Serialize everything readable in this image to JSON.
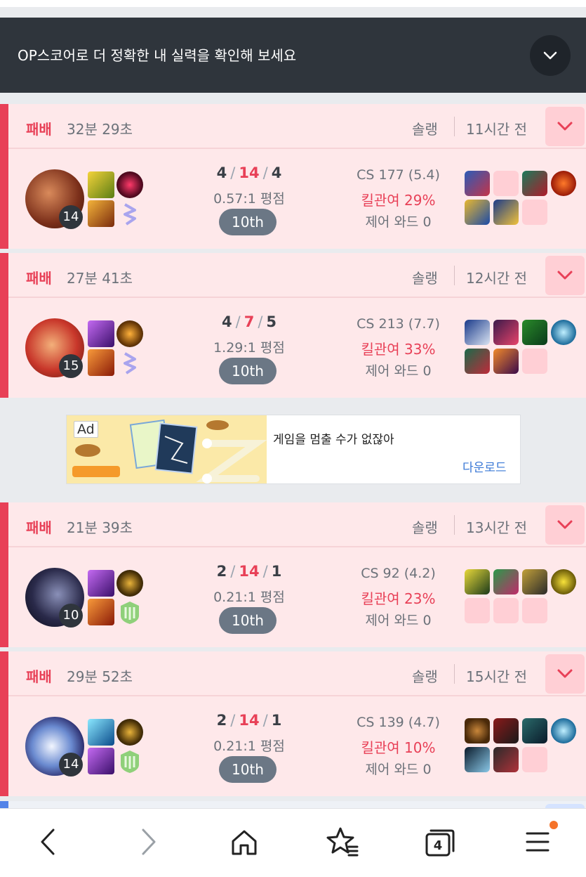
{
  "banner": {
    "text": "OP스코어로 더 정확한 내 실력을 확인해 보세요"
  },
  "matches": [
    {
      "result": "패배",
      "duration": "32분 29초",
      "queue": "솔랭",
      "ago": "11시간 전",
      "level": "14",
      "kills": "4",
      "deaths": "14",
      "assists": "4",
      "ratio": "0.57:1 평점",
      "placement": "10th",
      "cs": "CS 177 (5.4)",
      "kp": "킬관여 29%",
      "ward": "제어 와드 0"
    },
    {
      "result": "패배",
      "duration": "27분 41초",
      "queue": "솔랭",
      "ago": "12시간 전",
      "level": "15",
      "kills": "4",
      "deaths": "7",
      "assists": "5",
      "ratio": "1.29:1 평점",
      "placement": "10th",
      "cs": "CS 213 (7.7)",
      "kp": "킬관여 33%",
      "ward": "제어 와드 0"
    },
    {
      "result": "패배",
      "duration": "21분 39초",
      "queue": "솔랭",
      "ago": "13시간 전",
      "level": "10",
      "kills": "2",
      "deaths": "14",
      "assists": "1",
      "ratio": "0.21:1 평점",
      "placement": "10th",
      "cs": "CS 92 (4.2)",
      "kp": "킬관여 23%",
      "ward": "제어 와드 0"
    },
    {
      "result": "패배",
      "duration": "29분 52초",
      "queue": "솔랭",
      "ago": "15시간 전",
      "level": "14",
      "kills": "2",
      "deaths": "14",
      "assists": "1",
      "ratio": "0.21:1 평점",
      "placement": "10th",
      "cs": "CS 139 (4.7)",
      "kp": "킬관여 10%",
      "ward": "제어 와드 0"
    }
  ],
  "ad": {
    "badge": "Ad",
    "title": "게임을 멈출 수가 없잖아",
    "cta": "다운로드"
  },
  "tabs_count": "4",
  "colors": {
    "loss": "#e84057",
    "banner_bg": "#2f353c",
    "match_bg": "#fee8ea"
  },
  "icons": [
    "back-icon",
    "forward-icon",
    "home-icon",
    "star-bookmark-icon",
    "tabs-icon",
    "menu-icon",
    "chevron-down-icon"
  ]
}
